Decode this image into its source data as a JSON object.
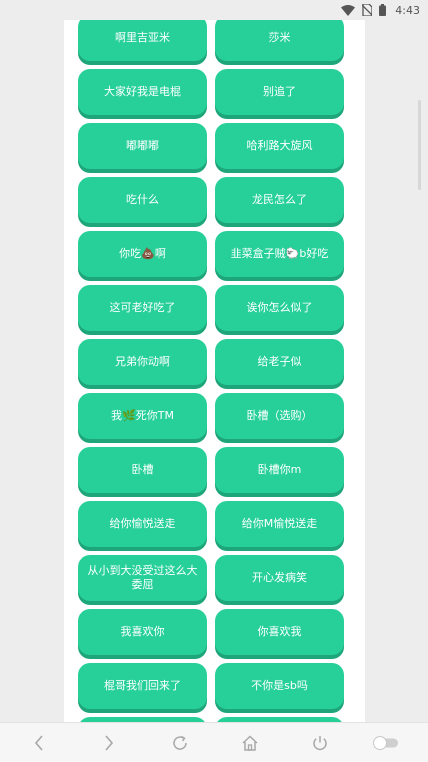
{
  "status_bar": {
    "time": "4:43",
    "icons": [
      "wifi-icon",
      "no-sim-icon",
      "battery-icon"
    ]
  },
  "theme": {
    "button_color": "#26d098",
    "button_shadow": "#1ea67a",
    "background": "#ededed"
  },
  "sound_buttons": [
    "啊里吉亚米",
    "莎米",
    "大家好我是电棍",
    "别追了",
    "嘟嘟嘟",
    "哈利路大旋风",
    "吃什么",
    "龙民怎么了",
    "你吃💩啊",
    "韭菜盒子贼🐑b好吃",
    "这可老好吃了",
    "诶你怎么似了",
    "兄弟你动啊",
    "给老子似",
    "我🌿死你TM",
    "卧槽（选购）",
    "卧槽",
    "卧槽你m",
    "给你愉悦送走",
    "给你M愉悦送走",
    "从小到大没受过这么大委屈",
    "开心发病笑",
    "我喜欢你",
    "你喜欢我",
    "棍哥我们回来了",
    "不你是sb吗",
    "",
    ""
  ],
  "bottom_nav": {
    "icons": [
      "back-icon",
      "forward-icon",
      "refresh-icon",
      "home-icon",
      "power-icon",
      "toggle-icon"
    ]
  }
}
